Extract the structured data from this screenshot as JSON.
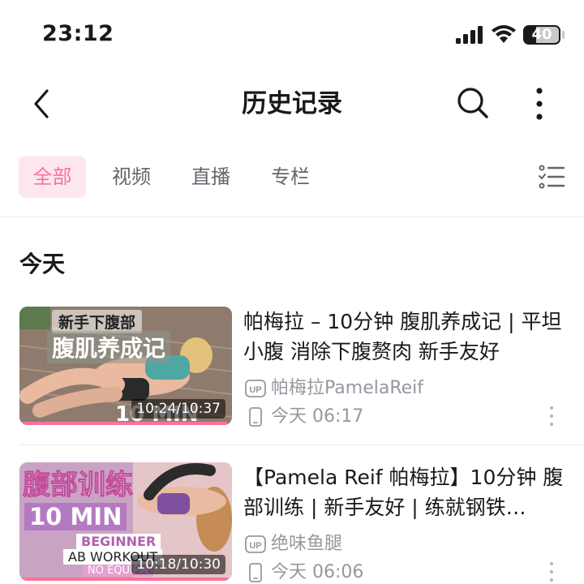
{
  "status_bar": {
    "time": "23:12",
    "battery": "40",
    "battery_level": 0.4
  },
  "header": {
    "title": "历史记录"
  },
  "tabs": [
    {
      "label": "全部",
      "active": true
    },
    {
      "label": "视频",
      "active": false
    },
    {
      "label": "直播",
      "active": false
    },
    {
      "label": "专栏",
      "active": false
    }
  ],
  "section": {
    "label": "今天"
  },
  "items": [
    {
      "title": "帕梅拉 – 10分钟 腹肌养成记 | 平坦小腹 消除下腹赘肉 新手友好",
      "uploader": "帕梅拉PamelaReif",
      "watched": "今天 06:17",
      "duration": "10:24/10:37",
      "progress": 0.977,
      "thumb_text_1": "新手下腹部",
      "thumb_text_2": "腹肌养成记",
      "thumb_text_3": "10 MIN"
    },
    {
      "title": "【Pamela Reif 帕梅拉】10分钟 腹部训练 | 新手友好 | 练就钢铁…",
      "uploader": "绝味鱼腿",
      "watched": "今天 06:06",
      "duration": "10:18/10:30",
      "progress": 0.981,
      "thumb_text_1": "腹部训练",
      "thumb_text_2": "10 MIN",
      "thumb_text_3": "BEGINNER",
      "thumb_text_4": "AB WORKOUT",
      "thumb_text_5": "NO EQUIPM"
    }
  ],
  "colors": {
    "accent": "#fb7299",
    "accent_bg": "#fde7ef",
    "text": "#18191c",
    "muted": "#9499a0"
  }
}
